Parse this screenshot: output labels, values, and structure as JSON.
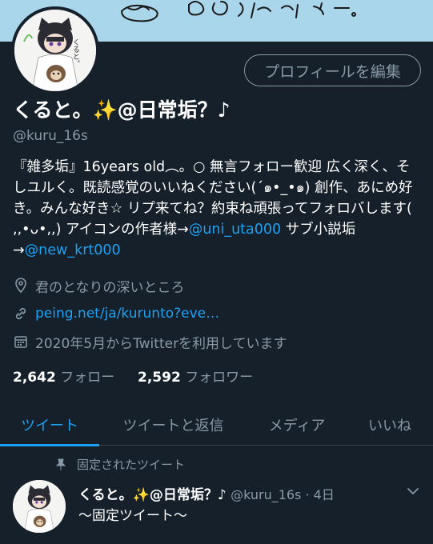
{
  "profile": {
    "display_name": "くると。✨@日常垢？♪",
    "handle": "@kuru_16s",
    "edit_button": "プロフィールを編集",
    "avatar_caption": "くると。"
  },
  "bio": {
    "part1": "『雑多垢』16years old︵。○ 無言フォロー歓迎  広く深く、そしユルく。既読感覚のいいねください(´๑•_•๑) 創作、あにめ好き。みんな好き☆ リプ来てね？約束ね頑張ってフォロバします( ,,•ᴗ•,,) アイコンの作者様→",
    "link1": "@uni_uta000",
    "part2": " サブ小説垢→",
    "link2": "@new_krt000"
  },
  "meta": {
    "location": "君のとなりの深いところ",
    "website": "peing.net/ja/kurunto?eve…",
    "joined": "2020年5月からTwitterを利用しています"
  },
  "stats": {
    "following_count": "2,642",
    "following_label": "フォロー",
    "followers_count": "2,592",
    "followers_label": "フォロワー"
  },
  "tabs": [
    {
      "label": "ツイート",
      "active": true
    },
    {
      "label": "ツイートと返信",
      "active": false
    },
    {
      "label": "メディア",
      "active": false
    },
    {
      "label": "いいね",
      "active": false
    }
  ],
  "pinned_tweet": {
    "pinned_label": "固定されたツイート",
    "author_name": "くると。✨@日常垢？♪",
    "author_handle": "@kuru_16s · 4日",
    "text": "〜固定ツイート〜"
  },
  "colors": {
    "background": "#15202b",
    "accent": "#1da1f2",
    "secondary_text": "#8899a6",
    "banner": "#a9d6ea"
  }
}
